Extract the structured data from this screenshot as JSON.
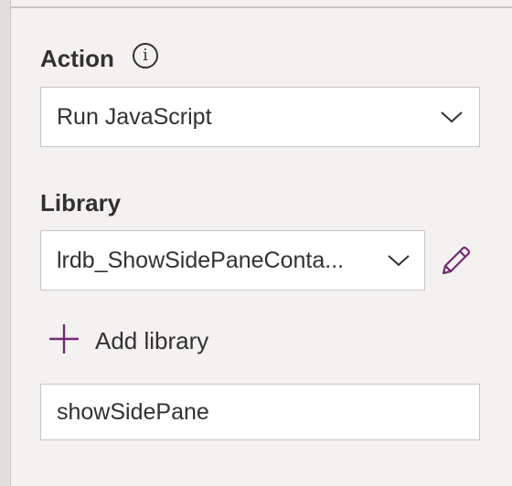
{
  "action": {
    "label": "Action",
    "info_icon": "info-icon",
    "selected_value": "Run JavaScript"
  },
  "library": {
    "label": "Library",
    "selected_value": "lrdb_ShowSidePaneConta...",
    "edit_icon": "pencil-icon",
    "add_label": "Add library"
  },
  "function_field": {
    "value": "showSidePane"
  },
  "colors": {
    "accent": "#742774",
    "background": "#f3f2f1",
    "field_border": "#c8c6c4",
    "text": "#323130"
  }
}
